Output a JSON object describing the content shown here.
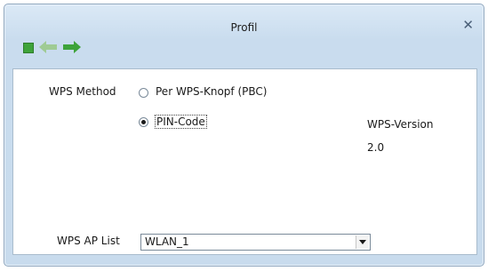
{
  "window": {
    "title": "Profil",
    "close_glyph": "✕"
  },
  "toolbar": {
    "stop_icon": "stop-icon",
    "back_icon": "back-arrow-icon",
    "forward_icon": "forward-arrow-icon",
    "arrow_color": "#3ea33a"
  },
  "wps": {
    "method_label": "WPS Method",
    "options": [
      {
        "label": "Per WPS-Knopf (PBC)",
        "selected": false
      },
      {
        "label": "PIN-Code",
        "selected": true
      }
    ],
    "version_label": "WPS-Version",
    "version_value": "2.0",
    "ap_list_label": "WPS AP List",
    "ap_list_value": "WLAN_1"
  }
}
